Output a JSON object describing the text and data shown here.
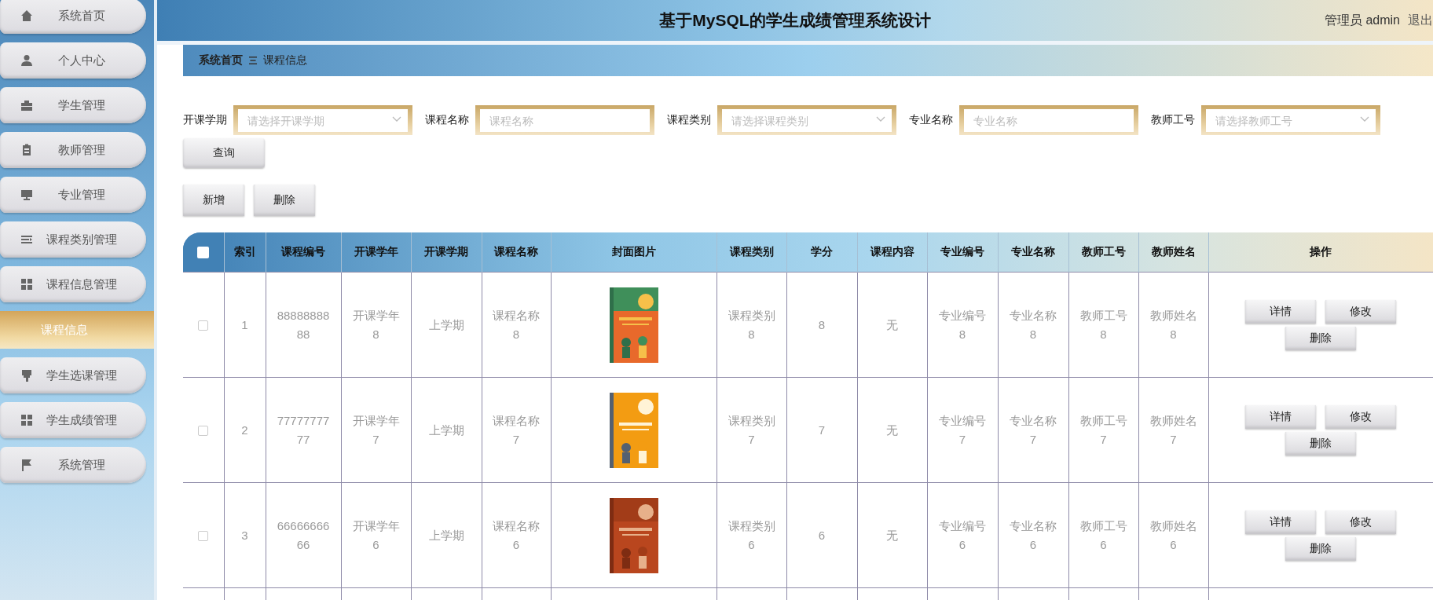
{
  "header": {
    "title": "基于MySQL的学生成绩管理系统设计",
    "user": "管理员 admin",
    "logout": "退出"
  },
  "sidebar": {
    "items": [
      {
        "label": "系统首页"
      },
      {
        "label": "个人中心"
      },
      {
        "label": "学生管理"
      },
      {
        "label": "教师管理"
      },
      {
        "label": "专业管理"
      },
      {
        "label": "课程类别管理"
      },
      {
        "label": "课程信息管理",
        "children": [
          {
            "label": "课程信息",
            "selected": true
          }
        ]
      },
      {
        "label": "学生选课管理"
      },
      {
        "label": "学生成绩管理"
      },
      {
        "label": "系统管理"
      }
    ]
  },
  "breadcrumb": [
    "系统首页",
    "课程信息"
  ],
  "filters": [
    {
      "label": "开课学期",
      "kind": "select",
      "placeholder": "请选择开课学期"
    },
    {
      "label": "课程名称",
      "kind": "input",
      "placeholder": "课程名称"
    },
    {
      "label": "课程类别",
      "kind": "select",
      "placeholder": "请选择课程类别"
    },
    {
      "label": "专业名称",
      "kind": "input",
      "placeholder": "专业名称"
    },
    {
      "label": "教师工号",
      "kind": "select",
      "placeholder": "请选择教师工号"
    }
  ],
  "search_button": "查询",
  "toolbar": [
    "新增",
    "删除"
  ],
  "table": {
    "select_all": {
      "checked": false
    },
    "columns": [
      "索引",
      "课程编号",
      "开课学年",
      "开课学期",
      "课程名称",
      "封面图片",
      "课程类别",
      "学分",
      "课程内容",
      "专业编号",
      "专业名称",
      "教师工号",
      "教师姓名",
      "操作"
    ],
    "rows": [
      {
        "checked": false,
        "cells": [
          "1",
          "8888888888",
          "开课学年8",
          "上学期",
          "课程名称8",
          {
            "kind": "picture"
          },
          "课程类别8",
          "8",
          "无",
          "专业编号8",
          "专业名称8",
          "教师工号8",
          "教师姓名8"
        ],
        "actions": [
          "详情",
          "修改",
          "删除"
        ]
      },
      {
        "checked": false,
        "cells": [
          "2",
          "7777777777",
          "开课学年7",
          "上学期",
          "课程名称7",
          {
            "kind": "picture"
          },
          "课程类别7",
          "7",
          "无",
          "专业编号7",
          "专业名称7",
          "教师工号7",
          "教师姓名7"
        ],
        "actions": [
          "详情",
          "修改",
          "删除"
        ]
      },
      {
        "checked": false,
        "cells": [
          "3",
          "6666666666",
          "开课学年6",
          "上学期",
          "课程名称6",
          {
            "kind": "picture"
          },
          "课程类别6",
          "6",
          "无",
          "专业编号6",
          "专业名称6",
          "教师工号6",
          "教师姓名6"
        ],
        "actions": [
          "详情",
          "修改",
          "删除"
        ]
      }
    ]
  }
}
